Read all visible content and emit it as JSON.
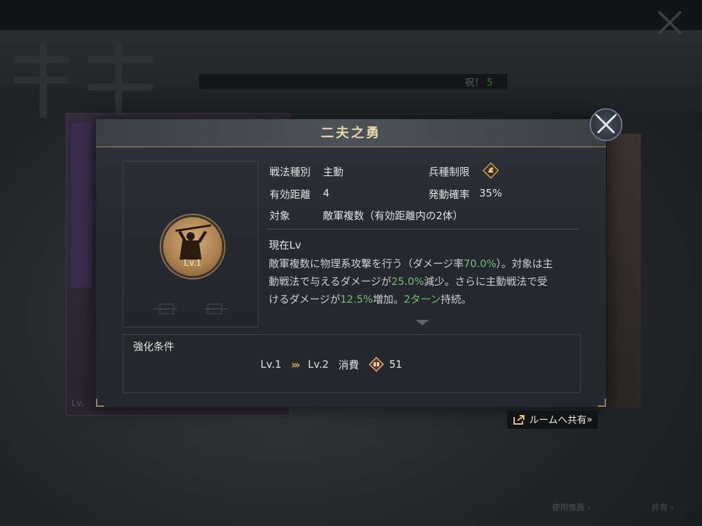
{
  "background": {
    "congrats_text": "祝！",
    "congrats_num": "5",
    "left_lv": "Lv.",
    "bottom_links": [
      "使用推薦 ›",
      "共有 ›"
    ]
  },
  "modal": {
    "title": "二夫之勇",
    "portrait": {
      "level": "Lv.1",
      "icon": "warrior-silhouette"
    },
    "info": {
      "tactic_type_label": "戦法種別",
      "tactic_type_value": "主動",
      "troop_restriction_label": "兵種制限",
      "troop_restriction_icon": "cavalry-icon",
      "range_label": "有効距離",
      "range_value": "4",
      "activation_label": "発動確率",
      "activation_value": "35%",
      "target_label": "対象",
      "target_value": "敵軍複数（有効距離内の2体）"
    },
    "description": {
      "title": "現在Lv",
      "line1_a": "敵軍複数に物理系攻撃を行う（ダメージ率",
      "line1_hl": "70.0%",
      "line1_b": "）。対象は主",
      "line2_a": "動戦法で与えるダメージが",
      "line2_hl": "25.0%",
      "line2_b": "減少。さらに主動戦法で受",
      "line3_a": "けるダメージが",
      "line3_hl": "12.5%",
      "line3_b": "増加。",
      "line3_hl2": "2ターン",
      "line3_c": "持続。"
    },
    "upgrade": {
      "title": "強化条件",
      "from": "Lv.1",
      "to": "Lv.2",
      "cost_label": "消費",
      "cost_icon": "tactic-point-icon",
      "cost_value": "51"
    }
  },
  "share": {
    "label": "ルームへ共有",
    "suffix": "»"
  },
  "colors": {
    "accent_gold": "#d4a94f",
    "highlight_green": "#6fbf7a",
    "title_gold": "#e8d7a8"
  }
}
